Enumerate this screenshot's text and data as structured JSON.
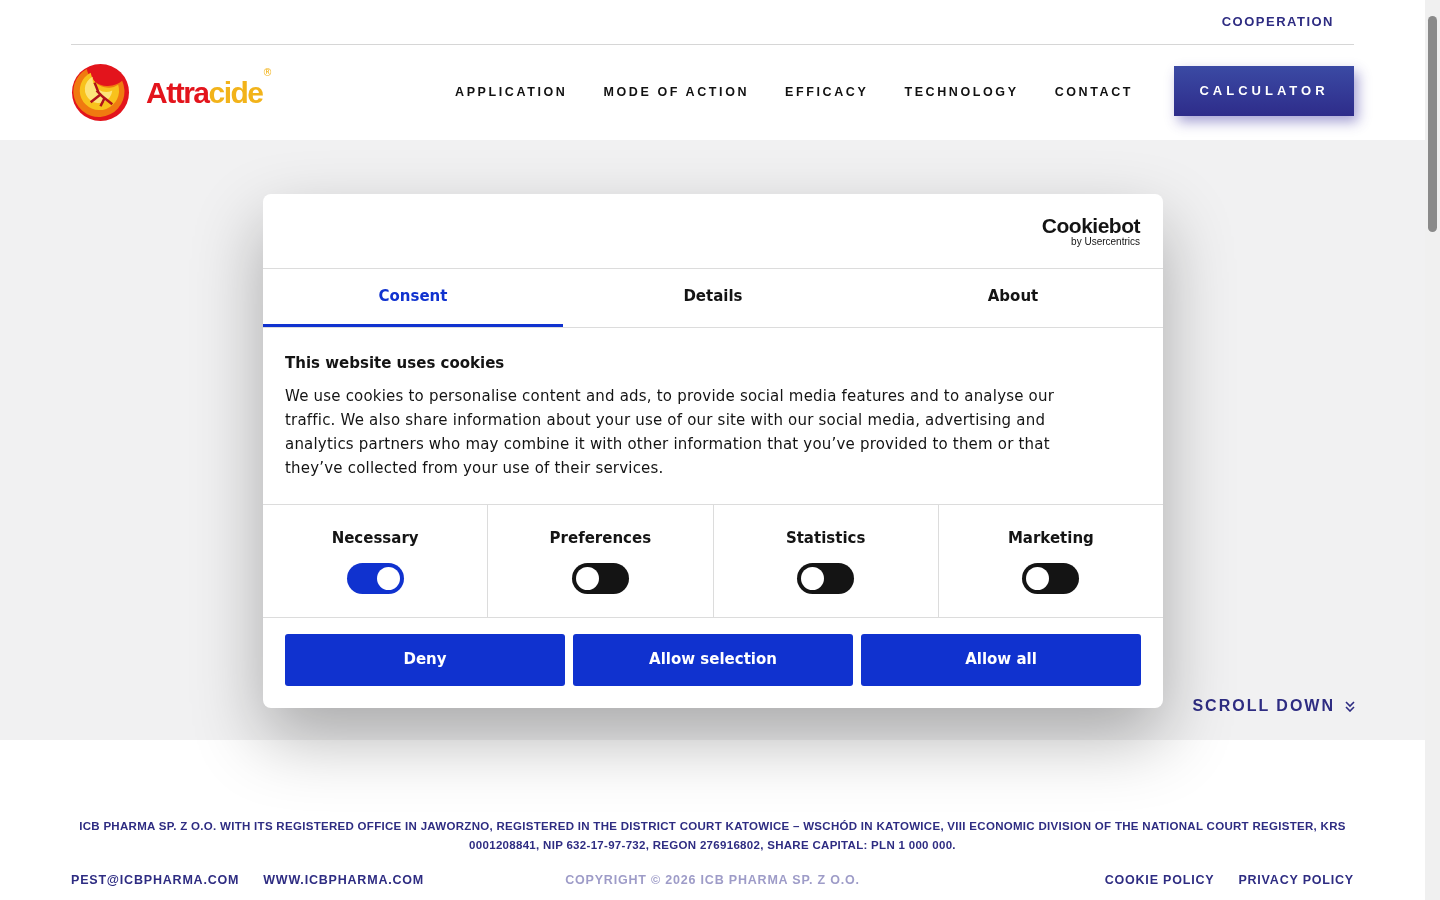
{
  "top_bar": {
    "link": "COOPERATION"
  },
  "logo": {
    "word_start": "Attra",
    "word_end": "cide",
    "mark": "®"
  },
  "nav": [
    {
      "label": "APPLICATION"
    },
    {
      "label": "MODE OF ACTION"
    },
    {
      "label": "EFFICACY"
    },
    {
      "label": "TECHNOLOGY"
    },
    {
      "label": "CONTACT"
    }
  ],
  "cta_button": "CALCULATOR",
  "hero": {
    "scroll_hint": "SCROLL DOWN"
  },
  "cookie_dialog": {
    "brand": "Cookiebot",
    "brand_sub": "by Usercentrics",
    "tabs": [
      {
        "label": "Consent",
        "selected": true
      },
      {
        "label": "Details",
        "selected": false
      },
      {
        "label": "About",
        "selected": false
      }
    ],
    "heading": "This website uses cookies",
    "body": "We use cookies to personalise content and ads, to provide social media features and to analyse our traffic. We also share information about your use of our site with our social media, advertising and analytics partners who may combine it with other information that you’ve provided to them or that they’ve collected from your use of their services.",
    "categories": [
      {
        "label": "Necessary",
        "checked": true
      },
      {
        "label": "Preferences",
        "checked": false
      },
      {
        "label": "Statistics",
        "checked": false
      },
      {
        "label": "Marketing",
        "checked": false
      }
    ],
    "buttons": [
      "Deny",
      "Allow selection",
      "Allow all"
    ]
  },
  "footer": {
    "legal": "ICB PHARMA SP. Z O.O. WITH ITS REGISTERED OFFICE IN JAWORZNO, REGISTERED IN THE DISTRICT COURT KATOWICE – WSCHÓD IN KATOWICE, VIII ECONOMIC DIVISION OF THE NATIONAL COURT REGISTER, KRS 0001208841, NIP 632-17-97-732, REGON 276916802, SHARE CAPITAL: PLN 1 000 000.",
    "contacts": [
      "PEST@ICBPHARMA.COM",
      "WWW.ICBPHARMA.COM"
    ],
    "copyright": "COPYRIGHT © 2026 ICB PHARMA SP. Z O.O.",
    "policies": [
      "COOKIE POLICY",
      "PRIVACY POLICY"
    ]
  }
}
